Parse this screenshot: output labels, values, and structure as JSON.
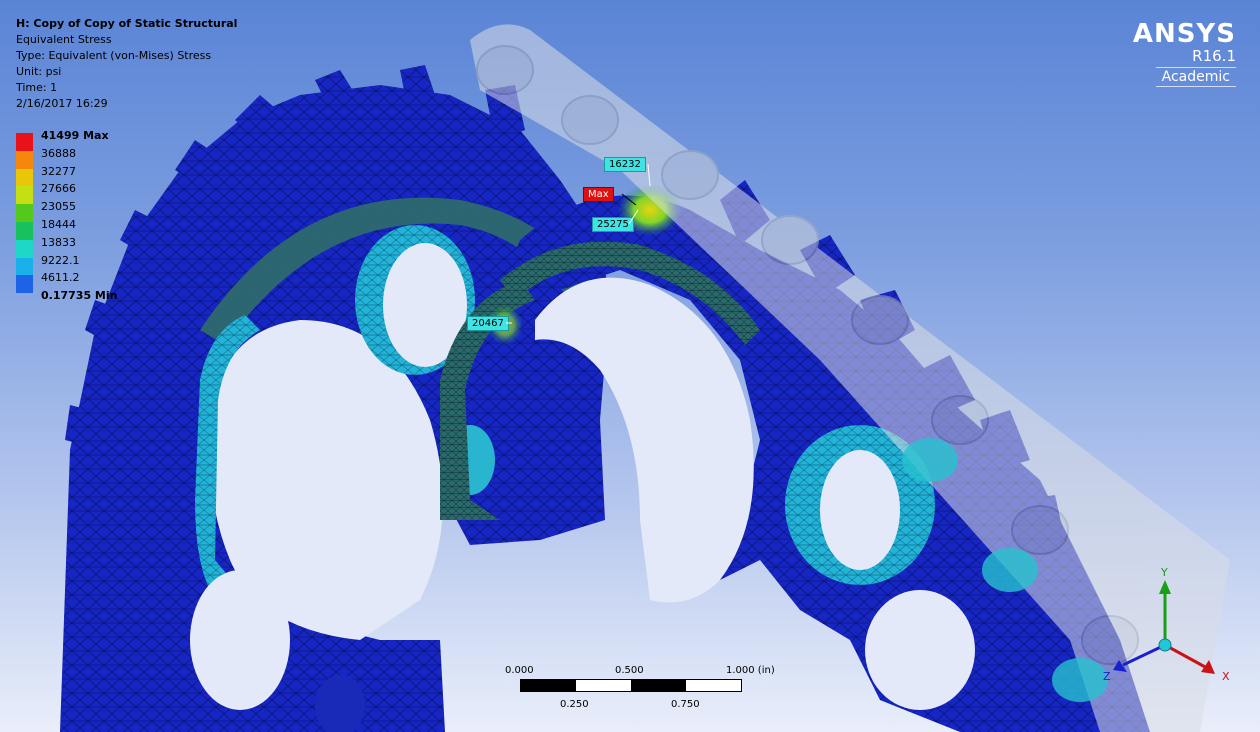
{
  "header": {
    "title": "H: Copy of Copy of Static Structural",
    "result_name": "Equivalent Stress",
    "type": "Type: Equivalent (von-Mises) Stress",
    "unit": "Unit: psi",
    "time": "Time: 1",
    "timestamp": "2/16/2017 16:29"
  },
  "legend": [
    {
      "label": "41499 Max",
      "color": "#e8121a",
      "bold": true
    },
    {
      "label": "36888",
      "color": "#f5870c"
    },
    {
      "label": "32277",
      "color": "#e8c70a"
    },
    {
      "label": "27666",
      "color": "#c4df12"
    },
    {
      "label": "23055",
      "color": "#55c91b"
    },
    {
      "label": "18444",
      "color": "#18c05e"
    },
    {
      "label": "13833",
      "color": "#1fd7c7"
    },
    {
      "label": "9222.1",
      "color": "#1ab1ea"
    },
    {
      "label": "4611.2",
      "color": "#1d63e8"
    },
    {
      "label": "0.17735 Min",
      "color": "#1622c9",
      "bold": true
    }
  ],
  "brand": {
    "name": "ANSYS",
    "version": "R16.1",
    "edition": "Academic"
  },
  "probes": {
    "p1": "16232",
    "max": "Max",
    "p2": "25275",
    "p3": "20467"
  },
  "scale": {
    "t0": "0.000",
    "t1": "0.500",
    "t2": "1.000 (in)",
    "b1": "0.250",
    "b2": "0.750"
  },
  "triad": {
    "y": "Y",
    "z": "Z",
    "x": "X"
  },
  "colors": {
    "mesh_blue": "#1626c4",
    "mesh_edge": "#0a0f5a",
    "chain": "#d8dde6"
  }
}
